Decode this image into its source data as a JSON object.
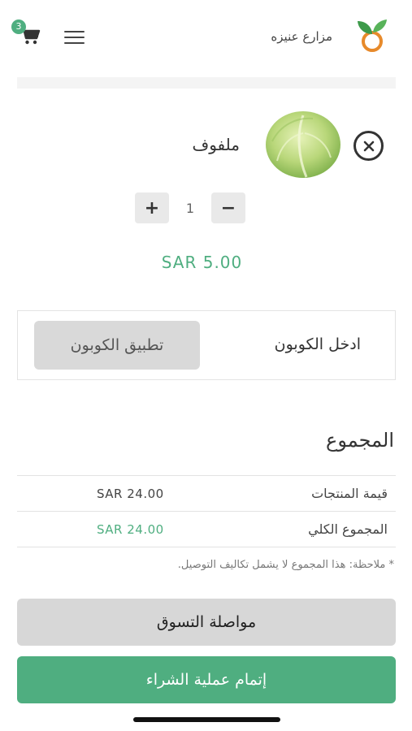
{
  "header": {
    "brand": "مزارع عنيزه",
    "cart_count": "3"
  },
  "item": {
    "name": "ملفوف",
    "quantity": "1",
    "minus": "−",
    "plus": "+",
    "price": "SAR 5.00"
  },
  "coupon": {
    "label": "ادخل الكوبون",
    "button": "تطبيق الكوبون"
  },
  "totals": {
    "title": "المجموع",
    "rows": [
      {
        "label": "قيمة المنتجات",
        "value": "SAR 24.00"
      },
      {
        "label": "المجموع الكلي",
        "value": "SAR 24.00"
      }
    ],
    "note": "* ملاحظة: هذا المجموع لا يشمل تكاليف التوصيل."
  },
  "actions": {
    "continue": "مواصلة التسوق",
    "checkout": "إتمام عملية الشراء"
  },
  "colors": {
    "accent": "#4fae80",
    "button_gray": "#d7d7d7"
  },
  "icons": [
    "cart-icon",
    "menu-icon",
    "logo-icon",
    "close-icon",
    "cabbage-image"
  ]
}
